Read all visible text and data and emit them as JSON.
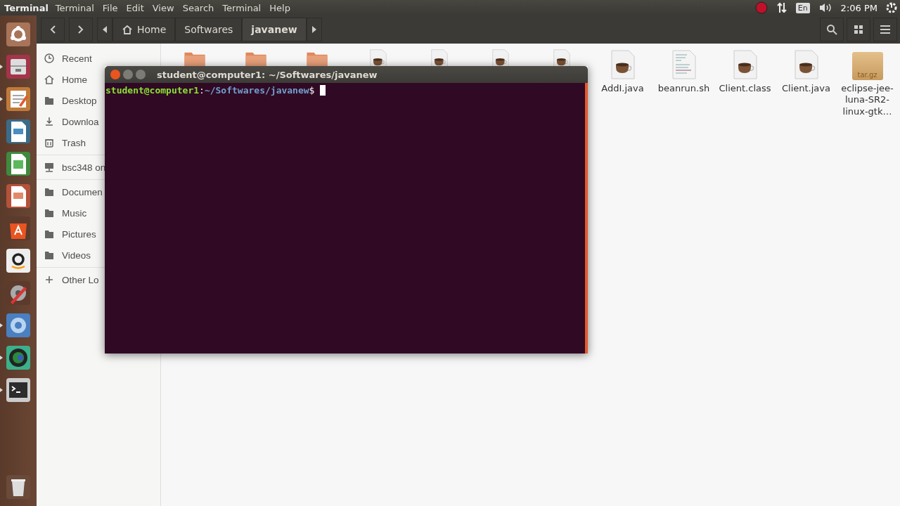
{
  "top_bar": {
    "app_name": "Terminal",
    "menus": [
      "Terminal",
      "File",
      "Edit",
      "View",
      "Search",
      "Terminal",
      "Help"
    ],
    "keyboard": "En",
    "clock": "2:06 PM"
  },
  "launcher": {
    "items": [
      {
        "kind": "dash",
        "running": false
      },
      {
        "kind": "files",
        "running": true
      },
      {
        "kind": "editor",
        "running": true
      },
      {
        "kind": "writer",
        "running": false
      },
      {
        "kind": "calc",
        "running": false
      },
      {
        "kind": "impress",
        "running": false
      },
      {
        "kind": "store",
        "running": false
      },
      {
        "kind": "amazon",
        "running": false
      },
      {
        "kind": "settings",
        "running": false
      },
      {
        "kind": "browser",
        "running": true
      },
      {
        "kind": "camera",
        "running": true
      },
      {
        "kind": "terminal",
        "running": true
      }
    ]
  },
  "path_bar": {
    "crumbs": [
      {
        "label": "Home",
        "kind": "home",
        "selected": false
      },
      {
        "label": "Softwares",
        "kind": "plain",
        "selected": false
      },
      {
        "label": "javanew",
        "kind": "plain",
        "selected": true
      }
    ]
  },
  "sidebar": {
    "groups": [
      [
        {
          "label": "Recent",
          "kind": "clock"
        },
        {
          "label": "Home",
          "kind": "home"
        },
        {
          "label": "Desktop",
          "kind": "folder"
        },
        {
          "label": "Downloa",
          "kind": "download"
        },
        {
          "label": "Trash",
          "kind": "trash"
        }
      ],
      [
        {
          "label": "bsc348 on",
          "kind": "network"
        }
      ],
      [
        {
          "label": "Documen",
          "kind": "folder"
        },
        {
          "label": "Music",
          "kind": "folder"
        },
        {
          "label": "Pictures",
          "kind": "folder"
        },
        {
          "label": "Videos",
          "kind": "folder"
        }
      ],
      [
        {
          "label": "Other Lo",
          "kind": "plus"
        }
      ]
    ]
  },
  "files": [
    {
      "kind": "folder"
    },
    {
      "kind": "folder"
    },
    {
      "kind": "folder"
    },
    {
      "kind": "java"
    },
    {
      "kind": "java"
    },
    {
      "kind": "java"
    },
    {
      "kind": "java"
    },
    {
      "kind": "java",
      "label": "AddI.java"
    },
    {
      "kind": "script",
      "label": "beanrun.sh"
    },
    {
      "kind": "java",
      "label": "Client.class"
    },
    {
      "kind": "java",
      "label": "Client.java"
    },
    {
      "kind": "archive",
      "label": "eclipse-jee-luna-SR2-linux-gtk…",
      "badge": "tar.gz"
    }
  ],
  "terminal": {
    "title": "student@computer1: ~/Softwares/javanew",
    "prompt": {
      "user_host": "student@computer1",
      "separator": ":",
      "path": "~/Softwares/javanew",
      "symbol": "$"
    }
  }
}
